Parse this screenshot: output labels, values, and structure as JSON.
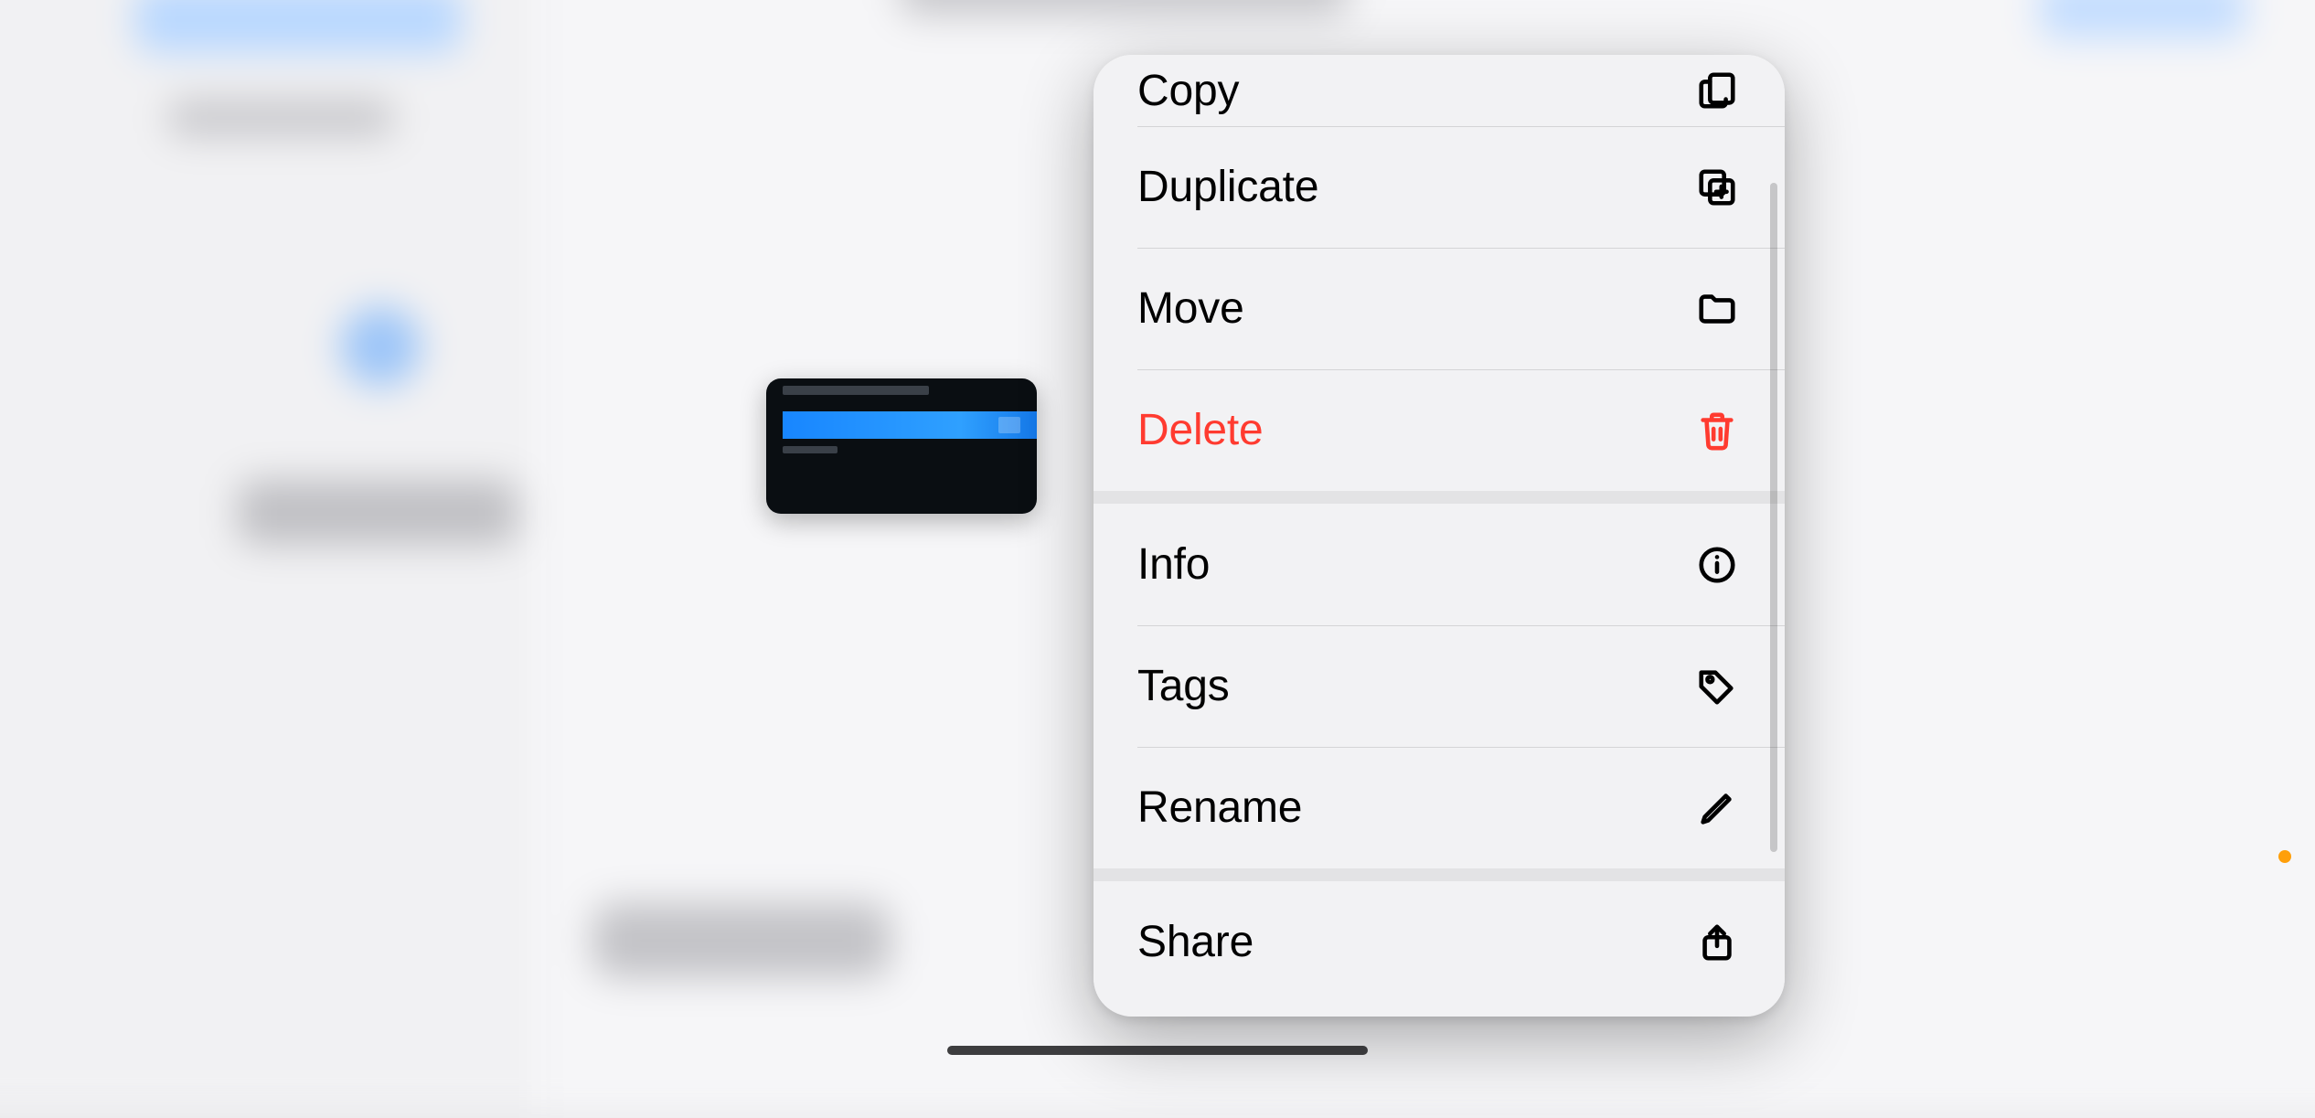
{
  "contextMenu": {
    "groups": [
      [
        {
          "key": "copy",
          "label": "Copy",
          "icon": "copy-icon",
          "destructive": false
        },
        {
          "key": "duplicate",
          "label": "Duplicate",
          "icon": "duplicate-icon",
          "destructive": false
        },
        {
          "key": "move",
          "label": "Move",
          "icon": "folder-icon",
          "destructive": false
        },
        {
          "key": "delete",
          "label": "Delete",
          "icon": "trash-icon",
          "destructive": true
        }
      ],
      [
        {
          "key": "info",
          "label": "Info",
          "icon": "info-icon",
          "destructive": false
        },
        {
          "key": "tags",
          "label": "Tags",
          "icon": "tag-icon",
          "destructive": false
        },
        {
          "key": "rename",
          "label": "Rename",
          "icon": "pencil-icon",
          "destructive": false
        }
      ],
      [
        {
          "key": "share",
          "label": "Share",
          "icon": "share-icon",
          "destructive": false
        }
      ]
    ]
  },
  "colors": {
    "destructive": "#ff3b30",
    "menuBackground": "#f2f2f4",
    "separator": "#e3e3e5"
  }
}
